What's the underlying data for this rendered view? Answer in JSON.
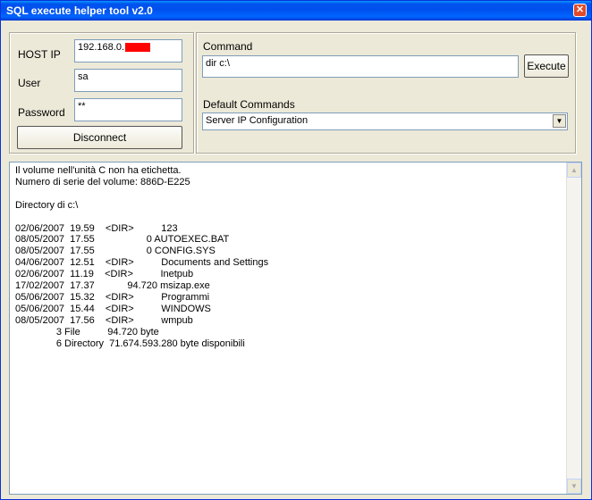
{
  "window": {
    "title": "SQL execute helper tool v2.0",
    "close_glyph": "✕"
  },
  "connection": {
    "host_label": "HOST IP",
    "host_value": "192.168.0.",
    "user_label": "User",
    "user_value": "sa",
    "password_label": "Password",
    "password_value": "**",
    "disconnect_label": "Disconnect"
  },
  "command": {
    "label": "Command",
    "value": "dir c:\\",
    "execute_label": "Execute",
    "default_label": "Default Commands",
    "default_selected": "Server IP Configuration"
  },
  "output": {
    "text": "Il volume nell'unità C non ha etichetta.\nNumero di serie del volume: 886D-E225\n\nDirectory di c:\\\n\n02/06/2007  19.59    <DIR>          123\n08/05/2007  17.55                   0 AUTOEXEC.BAT\n08/05/2007  17.55                   0 CONFIG.SYS\n04/06/2007  12.51    <DIR>          Documents and Settings\n02/06/2007  11.19    <DIR>          Inetpub\n17/02/2007  17.37            94.720 msizap.exe\n05/06/2007  15.32    <DIR>          Programmi\n05/06/2007  15.44    <DIR>          WINDOWS\n08/05/2007  17.56    <DIR>          wmpub\n               3 File          94.720 byte\n               6 Directory  71.674.593.280 byte disponibili"
  },
  "icons": {
    "scroll_up": "scroll-up-arrow",
    "scroll_down": "scroll-down-arrow",
    "dropdown": "dropdown-arrow"
  }
}
